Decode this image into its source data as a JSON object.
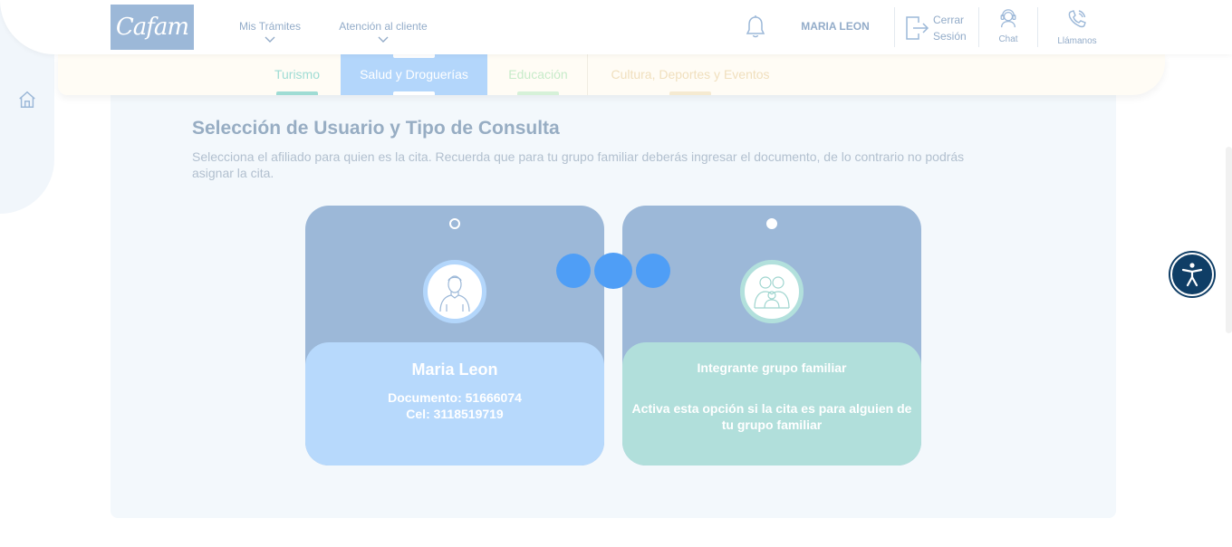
{
  "header": {
    "logo_text": "Cafam",
    "nav": [
      {
        "label": "Mis Trámites"
      },
      {
        "label": "Atención al cliente"
      }
    ],
    "user_name": "MARIA LEON",
    "logout_line1": "Cerrar",
    "logout_line2": "Sesión",
    "chat_label": "Chat",
    "call_label": "Llámanos"
  },
  "tabs": [
    {
      "label": "Turismo"
    },
    {
      "label": "Salud y Droguerías",
      "active": true
    },
    {
      "label": "Educación"
    },
    {
      "label": "Cultura, Deportes y Eventos"
    }
  ],
  "main": {
    "title": "Selección de Usuario y Tipo de Consulta",
    "description": "Selecciona el afiliado para quien es la cita. Recuerda que para tu grupo familiar deberás ingresar el documento, de lo contrario no podrás asignar la cita.",
    "user_card": {
      "name": "Maria Leon",
      "document": "Documento: 51666074",
      "phone": "Cel: 3118519719",
      "selected": true
    },
    "family_card": {
      "title": "Integrante grupo familiar",
      "description": "Activa esta opción si la cita es para alguien de tu grupo familiar",
      "selected": false
    }
  },
  "colors": {
    "primary_soft": "#9cb8d8",
    "card_user_bottom": "#b7d9fc",
    "card_family_bottom": "#b1dfdb",
    "loader": "#4f9ef6",
    "accessibility_button": "#0f3e66"
  },
  "icons": {
    "home": "home-icon",
    "bell": "bell-icon",
    "logout": "logout-icon",
    "chat": "headset-icon",
    "call": "phone-icon",
    "accessibility": "accessibility-icon"
  }
}
